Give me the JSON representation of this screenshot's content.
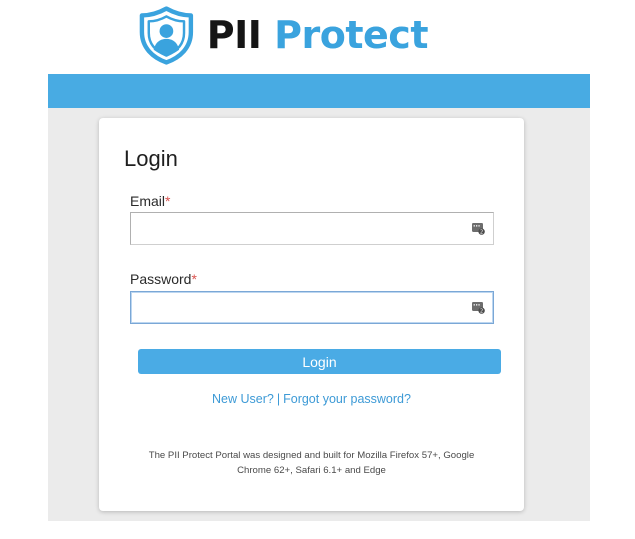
{
  "brand": {
    "name_part1": "PII",
    "name_part2": "Protect",
    "icon": "shield-user-icon",
    "colors": {
      "accent": "#3aa3de",
      "banner": "#48abe3",
      "dark_text": "#151515"
    }
  },
  "login": {
    "title": "Login",
    "email": {
      "label": "Email",
      "required_mark": "*",
      "value": "",
      "icon": "password-manager-icon"
    },
    "password": {
      "label": "Password",
      "required_mark": "*",
      "value": "",
      "icon": "password-manager-icon"
    },
    "submit_label": "Login",
    "links": {
      "new_user": "New User?",
      "separator": "|",
      "forgot_password": "Forgot your password?"
    },
    "disclaimer_line1": "The PII Protect Portal was designed and built for Mozilla Firefox 57+, Google",
    "disclaimer_line2": "Chrome 62+, Safari 6.1+ and Edge"
  }
}
